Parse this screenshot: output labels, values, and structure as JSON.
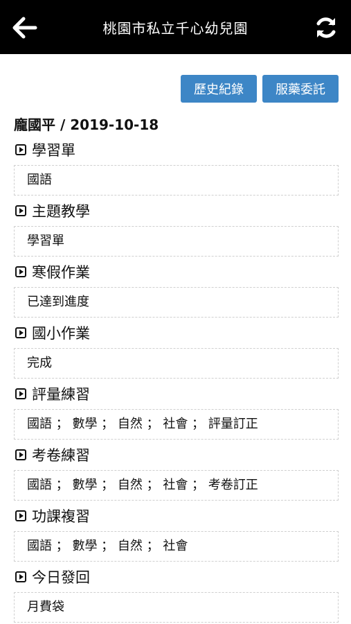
{
  "header": {
    "title": "桃園市私立千心幼兒園",
    "back_icon": "arrow-left-icon",
    "refresh_icon": "refresh-icon"
  },
  "actions": {
    "history_label": "歷史紀錄",
    "medication_label": "服藥委託"
  },
  "student": {
    "name": "龐國平",
    "separator": " / ",
    "date": "2019-10-18"
  },
  "sections": [
    {
      "title": "學習單",
      "value": "國語"
    },
    {
      "title": "主題教學",
      "value": "學習單"
    },
    {
      "title": "寒假作業",
      "value": "已達到進度"
    },
    {
      "title": "國小作業",
      "value": "完成"
    },
    {
      "title": "評量練習",
      "value": "國語 ； 數學 ； 自然 ； 社會 ； 評量訂正"
    },
    {
      "title": "考卷練習",
      "value": "國語 ； 數學 ； 自然 ； 社會 ； 考卷訂正"
    },
    {
      "title": "功課複習",
      "value": "國語 ； 數學 ； 自然 ； 社會"
    },
    {
      "title": "今日發回",
      "value": "月費袋"
    }
  ],
  "colors": {
    "header_bg": "#000000",
    "button_bg": "#3d86c6"
  }
}
